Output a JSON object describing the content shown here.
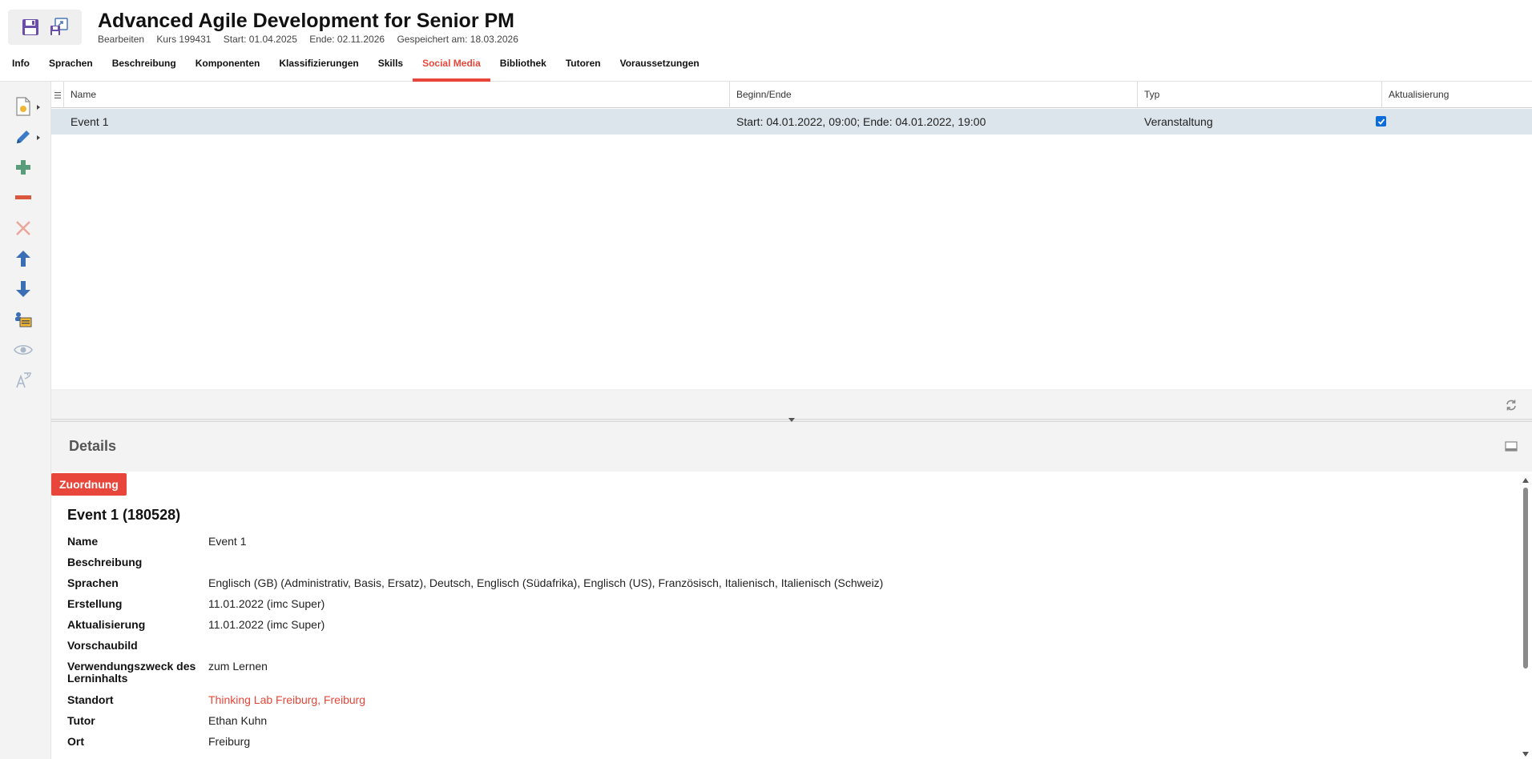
{
  "header": {
    "title": "Advanced Agile Development for Senior PM",
    "meta": {
      "mode": "Bearbeiten",
      "course": "Kurs 199431",
      "start": "Start: 01.04.2025",
      "end": "Ende: 02.11.2026",
      "saved": "Gespeichert am: 18.03.2026"
    },
    "tools": [
      {
        "icon": "save-icon"
      },
      {
        "icon": "save-as-icon"
      }
    ]
  },
  "tabs": [
    {
      "label": "Info"
    },
    {
      "label": "Sprachen"
    },
    {
      "label": "Beschreibung"
    },
    {
      "label": "Komponenten"
    },
    {
      "label": "Klassifizierungen"
    },
    {
      "label": "Skills"
    },
    {
      "label": "Social Media",
      "active": true
    },
    {
      "label": "Bibliothek"
    },
    {
      "label": "Tutoren"
    },
    {
      "label": "Voraussetzungen"
    }
  ],
  "toolbar": {
    "icons": [
      "new-document-icon",
      "edit-pencil-icon",
      "add-icon",
      "remove-icon",
      "delete-icon",
      "move-up-icon",
      "move-down-icon",
      "assign-icon",
      "preview-eye-icon",
      "translate-icon"
    ]
  },
  "grid": {
    "columns": [
      "Name",
      "Beginn/Ende",
      "Typ",
      "Aktualisierung"
    ],
    "rows": [
      {
        "name": "Event 1",
        "period": "Start: 04.01.2022, 09:00; Ende: 04.01.2022, 19:00",
        "type": "Veranstaltung",
        "update": true
      }
    ]
  },
  "details": {
    "title": "Details",
    "badge": "Zuordnung",
    "record_title": "Event 1 (180528)",
    "fields": [
      {
        "label": "Name",
        "value": "Event 1"
      },
      {
        "label": "Beschreibung",
        "value": ""
      },
      {
        "label": "Sprachen",
        "value": "Englisch (GB) (Administrativ, Basis, Ersatz), Deutsch, Englisch (Südafrika), Englisch (US), Französisch, Italienisch, Italienisch (Schweiz)"
      },
      {
        "label": "Erstellung",
        "value": "11.01.2022 (imc Super)"
      },
      {
        "label": "Aktualisierung",
        "value": "11.01.2022 (imc Super)"
      },
      {
        "label": "Vorschaubild",
        "value": ""
      },
      {
        "label": "Verwendungszweck des Lerninhalts",
        "value": "zum Lernen"
      },
      {
        "label": "Standort",
        "value": "Thinking Lab Freiburg, Freiburg"
      },
      {
        "label": "Tutor",
        "value": "Ethan Kuhn"
      },
      {
        "label": "Ort",
        "value": "Freiburg"
      }
    ]
  },
  "colors": {
    "accent": "#e8463a",
    "selected_row": "#dde5ec",
    "toolbar_bg": "#f3f3f3",
    "checkbox": "#0a6cd9"
  }
}
